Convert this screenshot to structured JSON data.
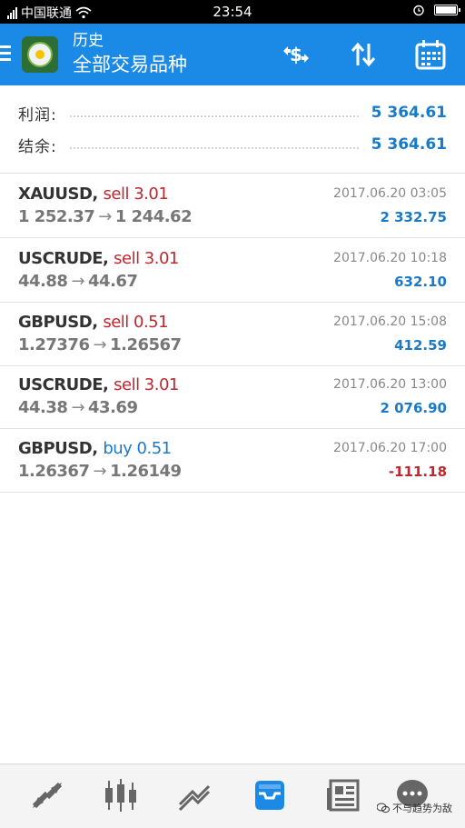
{
  "status_bar": {
    "carrier": "中国联通",
    "time": "23:54"
  },
  "header": {
    "title": "历史",
    "subtitle": "全部交易品种",
    "accent_color": "#1a8ae6",
    "actions": [
      "dollar-swap-icon",
      "sort-icon",
      "calendar-icon"
    ]
  },
  "summary": {
    "profit_label": "利润:",
    "profit_value": "5 364.61",
    "balance_label": "结余:",
    "balance_value": "5 364.61"
  },
  "trades": [
    {
      "symbol": "XAUUSD,",
      "direction": "sell 3.01",
      "type": "sell",
      "open": "1 252.37",
      "close": "1 244.62",
      "time": "2017.06.20 03:05",
      "profit": "2 332.75",
      "profit_sign": "pos"
    },
    {
      "symbol": "USCRUDE,",
      "direction": "sell 3.01",
      "type": "sell",
      "open": "44.88",
      "close": "44.67",
      "time": "2017.06.20 10:18",
      "profit": "632.10",
      "profit_sign": "pos"
    },
    {
      "symbol": "GBPUSD,",
      "direction": "sell 0.51",
      "type": "sell",
      "open": "1.27376",
      "close": "1.26567",
      "time": "2017.06.20 15:08",
      "profit": "412.59",
      "profit_sign": "pos"
    },
    {
      "symbol": "USCRUDE,",
      "direction": "sell 3.01",
      "type": "sell",
      "open": "44.38",
      "close": "43.69",
      "time": "2017.06.20 13:00",
      "profit": "2 076.90",
      "profit_sign": "pos"
    },
    {
      "symbol": "GBPUSD,",
      "direction": "buy 0.51",
      "type": "buy",
      "open": "1.26367",
      "close": "1.26149",
      "time": "2017.06.20 17:00",
      "profit": "-111.18",
      "profit_sign": "neg"
    }
  ],
  "arrow": "→",
  "bottom_nav": {
    "items": [
      "quotes-icon",
      "chart-icon",
      "trade-icon",
      "history-icon",
      "news-icon",
      "messages-icon"
    ],
    "active": "history-icon"
  },
  "watermark": "不与趋势为敌"
}
